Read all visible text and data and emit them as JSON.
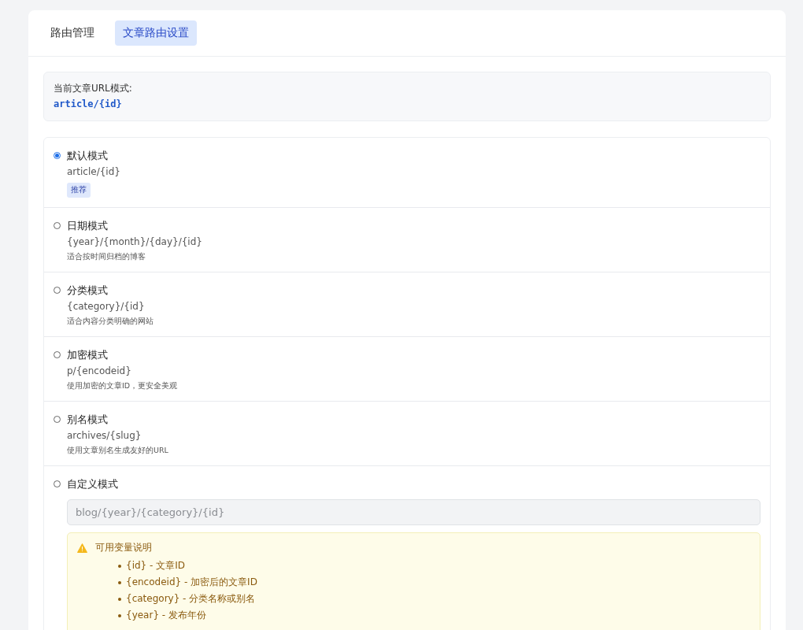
{
  "tabs": [
    {
      "label": "路由管理",
      "selected": false
    },
    {
      "label": "文章路由设置",
      "selected": true
    }
  ],
  "current": {
    "label": "当前文章URL模式:",
    "value": "article/{id}"
  },
  "modes": [
    {
      "title": "默认模式",
      "pattern": "article/{id}",
      "badge": "推荐",
      "selected": true
    },
    {
      "title": "日期模式",
      "pattern": "{year}/{month}/{day}/{id}",
      "description": "适合按时间归档的博客",
      "selected": false
    },
    {
      "title": "分类模式",
      "pattern": "{category}/{id}",
      "description": "适合内容分类明确的网站",
      "selected": false
    },
    {
      "title": "加密模式",
      "pattern": "p/{encodeid}",
      "description": "使用加密的文章ID，更安全美观",
      "selected": false
    },
    {
      "title": "别名模式",
      "pattern": "archives/{slug}",
      "description": "使用文章别名生成友好的URL",
      "selected": false
    },
    {
      "title": "自定义模式",
      "selected": false,
      "input": {
        "value": "blog/{year}/{category}/{id}",
        "disabled": true
      },
      "help": {
        "title": "可用变量说明",
        "items": [
          "{id} - 文章ID",
          "{encodeid} - 加密后的文章ID",
          "{category} - 分类名称或别名",
          "{year} - 发布年份"
        ]
      }
    }
  ]
}
